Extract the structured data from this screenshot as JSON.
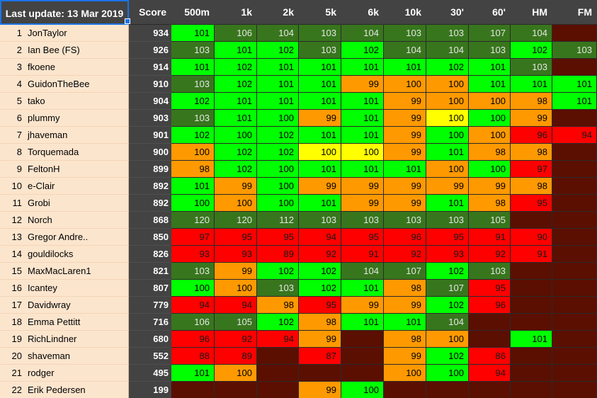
{
  "sheet": {
    "update_label": "Last update: 13 Mar 2019",
    "score_header": "Score",
    "columns": [
      "500m",
      "1k",
      "2k",
      "5k",
      "6k",
      "10k",
      "30'",
      "60'",
      "HM",
      "FM"
    ]
  },
  "colors": {
    "header_bg": "#434343",
    "name_bg": "#fce5cd",
    "dark_green": "#38761d",
    "green": "#00ff00",
    "orange": "#ff9900",
    "yellow": "#ffff00",
    "red": "#ff0000",
    "no_result": "#5b0f00",
    "selection": "#1a73e8"
  },
  "rows": [
    {
      "rank": "1",
      "name": "JonTaylor",
      "score": "934",
      "cells": [
        [
          "101",
          "g"
        ],
        [
          "106",
          "d"
        ],
        [
          "104",
          "d"
        ],
        [
          "103",
          "d"
        ],
        [
          "104",
          "d"
        ],
        [
          "103",
          "d"
        ],
        [
          "103",
          "d"
        ],
        [
          "107",
          "d"
        ],
        [
          "104",
          "d"
        ],
        [
          "",
          "x"
        ]
      ]
    },
    {
      "rank": "2",
      "name": "Ian Bee (FS)",
      "score": "926",
      "cells": [
        [
          "103",
          "d"
        ],
        [
          "101",
          "g"
        ],
        [
          "102",
          "g"
        ],
        [
          "103",
          "d"
        ],
        [
          "102",
          "g"
        ],
        [
          "104",
          "d"
        ],
        [
          "104",
          "d"
        ],
        [
          "103",
          "d"
        ],
        [
          "102",
          "g"
        ],
        [
          "103",
          "d"
        ]
      ]
    },
    {
      "rank": "3",
      "name": "fkoene",
      "score": "914",
      "cells": [
        [
          "101",
          "g"
        ],
        [
          "102",
          "g"
        ],
        [
          "101",
          "g"
        ],
        [
          "101",
          "g"
        ],
        [
          "101",
          "g"
        ],
        [
          "101",
          "g"
        ],
        [
          "102",
          "g"
        ],
        [
          "101",
          "g"
        ],
        [
          "103",
          "d"
        ],
        [
          "",
          "x"
        ]
      ]
    },
    {
      "rank": "4",
      "name": "GuidonTheBee",
      "score": "910",
      "cells": [
        [
          "103",
          "d"
        ],
        [
          "102",
          "g"
        ],
        [
          "101",
          "g"
        ],
        [
          "101",
          "g"
        ],
        [
          "99",
          "o"
        ],
        [
          "100",
          "o"
        ],
        [
          "100",
          "o"
        ],
        [
          "101",
          "g"
        ],
        [
          "101",
          "g"
        ],
        [
          "101",
          "g"
        ]
      ]
    },
    {
      "rank": "5",
      "name": "tako",
      "score": "904",
      "cells": [
        [
          "102",
          "g"
        ],
        [
          "101",
          "g"
        ],
        [
          "101",
          "g"
        ],
        [
          "101",
          "g"
        ],
        [
          "101",
          "g"
        ],
        [
          "99",
          "o"
        ],
        [
          "100",
          "o"
        ],
        [
          "100",
          "o"
        ],
        [
          "98",
          "o"
        ],
        [
          "101",
          "g"
        ]
      ]
    },
    {
      "rank": "6",
      "name": "plummy",
      "score": "903",
      "cells": [
        [
          "103",
          "d"
        ],
        [
          "101",
          "g"
        ],
        [
          "100",
          "g"
        ],
        [
          "99",
          "o"
        ],
        [
          "101",
          "g"
        ],
        [
          "99",
          "o"
        ],
        [
          "100",
          "y"
        ],
        [
          "100",
          "g"
        ],
        [
          "99",
          "o"
        ],
        [
          "",
          "x"
        ]
      ]
    },
    {
      "rank": "7",
      "name": "jhaveman",
      "score": "901",
      "cells": [
        [
          "102",
          "g"
        ],
        [
          "100",
          "g"
        ],
        [
          "102",
          "g"
        ],
        [
          "101",
          "g"
        ],
        [
          "101",
          "g"
        ],
        [
          "99",
          "o"
        ],
        [
          "100",
          "g"
        ],
        [
          "100",
          "o"
        ],
        [
          "96",
          "r"
        ],
        [
          "94",
          "r"
        ]
      ]
    },
    {
      "rank": "8",
      "name": "Torquemada",
      "score": "900",
      "cells": [
        [
          "100",
          "o"
        ],
        [
          "102",
          "g"
        ],
        [
          "102",
          "g"
        ],
        [
          "100",
          "y"
        ],
        [
          "100",
          "y"
        ],
        [
          "99",
          "o"
        ],
        [
          "101",
          "g"
        ],
        [
          "98",
          "o"
        ],
        [
          "98",
          "o"
        ],
        [
          "",
          "x"
        ]
      ]
    },
    {
      "rank": "9",
      "name": "FeltonH",
      "score": "899",
      "cells": [
        [
          "98",
          "o"
        ],
        [
          "102",
          "g"
        ],
        [
          "100",
          "g"
        ],
        [
          "101",
          "g"
        ],
        [
          "101",
          "g"
        ],
        [
          "101",
          "g"
        ],
        [
          "100",
          "o"
        ],
        [
          "100",
          "g"
        ],
        [
          "97",
          "r"
        ],
        [
          "",
          "x"
        ]
      ]
    },
    {
      "rank": "10",
      "name": "e-Clair",
      "score": "892",
      "cells": [
        [
          "101",
          "g"
        ],
        [
          "99",
          "o"
        ],
        [
          "100",
          "g"
        ],
        [
          "99",
          "o"
        ],
        [
          "99",
          "o"
        ],
        [
          "99",
          "o"
        ],
        [
          "99",
          "o"
        ],
        [
          "99",
          "o"
        ],
        [
          "98",
          "o"
        ],
        [
          "",
          "x"
        ]
      ]
    },
    {
      "rank": "11",
      "name": "Grobi",
      "score": "892",
      "cells": [
        [
          "100",
          "g"
        ],
        [
          "100",
          "o"
        ],
        [
          "100",
          "g"
        ],
        [
          "101",
          "g"
        ],
        [
          "99",
          "o"
        ],
        [
          "99",
          "o"
        ],
        [
          "101",
          "g"
        ],
        [
          "98",
          "o"
        ],
        [
          "95",
          "r"
        ],
        [
          "",
          "x"
        ]
      ]
    },
    {
      "rank": "12",
      "name": "Norch",
      "score": "868",
      "cells": [
        [
          "120",
          "d"
        ],
        [
          "120",
          "d"
        ],
        [
          "112",
          "d"
        ],
        [
          "103",
          "d"
        ],
        [
          "103",
          "d"
        ],
        [
          "103",
          "d"
        ],
        [
          "103",
          "d"
        ],
        [
          "105",
          "d"
        ],
        [
          "",
          "x"
        ],
        [
          "",
          "x"
        ]
      ]
    },
    {
      "rank": "13",
      "name": "Gregor Andre..",
      "score": "850",
      "cells": [
        [
          "97",
          "r"
        ],
        [
          "95",
          "r"
        ],
        [
          "95",
          "r"
        ],
        [
          "94",
          "r"
        ],
        [
          "95",
          "r"
        ],
        [
          "96",
          "r"
        ],
        [
          "95",
          "r"
        ],
        [
          "91",
          "r"
        ],
        [
          "90",
          "r"
        ],
        [
          "",
          "x"
        ]
      ]
    },
    {
      "rank": "14",
      "name": "gouldilocks",
      "score": "826",
      "cells": [
        [
          "93",
          "r"
        ],
        [
          "93",
          "r"
        ],
        [
          "89",
          "r"
        ],
        [
          "92",
          "r"
        ],
        [
          "91",
          "r"
        ],
        [
          "92",
          "r"
        ],
        [
          "93",
          "r"
        ],
        [
          "92",
          "r"
        ],
        [
          "91",
          "r"
        ],
        [
          "",
          "x"
        ]
      ]
    },
    {
      "rank": "15",
      "name": "MaxMacLaren1",
      "score": "821",
      "cells": [
        [
          "103",
          "d"
        ],
        [
          "99",
          "o"
        ],
        [
          "102",
          "g"
        ],
        [
          "102",
          "g"
        ],
        [
          "104",
          "d"
        ],
        [
          "107",
          "d"
        ],
        [
          "102",
          "g"
        ],
        [
          "103",
          "d"
        ],
        [
          "",
          "x"
        ],
        [
          "",
          "x"
        ]
      ]
    },
    {
      "rank": "16",
      "name": "Icantey",
      "score": "807",
      "cells": [
        [
          "100",
          "g"
        ],
        [
          "100",
          "o"
        ],
        [
          "103",
          "d"
        ],
        [
          "102",
          "g"
        ],
        [
          "101",
          "g"
        ],
        [
          "98",
          "o"
        ],
        [
          "107",
          "d"
        ],
        [
          "95",
          "r"
        ],
        [
          "",
          "x"
        ],
        [
          "",
          "x"
        ]
      ]
    },
    {
      "rank": "17",
      "name": "Davidwray",
      "score": "779",
      "cells": [
        [
          "94",
          "r"
        ],
        [
          "94",
          "r"
        ],
        [
          "98",
          "o"
        ],
        [
          "95",
          "r"
        ],
        [
          "99",
          "o"
        ],
        [
          "99",
          "o"
        ],
        [
          "102",
          "g"
        ],
        [
          "96",
          "r"
        ],
        [
          "",
          "x"
        ],
        [
          "",
          "x"
        ]
      ]
    },
    {
      "rank": "18",
      "name": "Emma Pettitt",
      "score": "716",
      "cells": [
        [
          "106",
          "d"
        ],
        [
          "105",
          "d"
        ],
        [
          "102",
          "g"
        ],
        [
          "98",
          "o"
        ],
        [
          "101",
          "g"
        ],
        [
          "101",
          "g"
        ],
        [
          "104",
          "d"
        ],
        [
          "",
          "x"
        ],
        [
          "",
          "x"
        ],
        [
          "",
          "x"
        ]
      ]
    },
    {
      "rank": "19",
      "name": "RichLindner",
      "score": "680",
      "cells": [
        [
          "96",
          "r"
        ],
        [
          "92",
          "r"
        ],
        [
          "94",
          "r"
        ],
        [
          "99",
          "o"
        ],
        [
          "",
          "x"
        ],
        [
          "98",
          "o"
        ],
        [
          "100",
          "o"
        ],
        [
          "",
          "x"
        ],
        [
          "101",
          "g"
        ],
        [
          "",
          "x"
        ]
      ]
    },
    {
      "rank": "20",
      "name": "shaveman",
      "score": "552",
      "cells": [
        [
          "88",
          "r"
        ],
        [
          "89",
          "r"
        ],
        [
          "",
          "x"
        ],
        [
          "87",
          "r"
        ],
        [
          "",
          "x"
        ],
        [
          "99",
          "o"
        ],
        [
          "102",
          "g"
        ],
        [
          "86",
          "r"
        ],
        [
          "",
          "x"
        ],
        [
          "",
          "x"
        ]
      ]
    },
    {
      "rank": "21",
      "name": "rodger",
      "score": "495",
      "cells": [
        [
          "101",
          "g"
        ],
        [
          "100",
          "o"
        ],
        [
          "",
          "x"
        ],
        [
          "",
          "x"
        ],
        [
          "",
          "x"
        ],
        [
          "100",
          "o"
        ],
        [
          "100",
          "g"
        ],
        [
          "94",
          "r"
        ],
        [
          "",
          "x"
        ],
        [
          "",
          "x"
        ]
      ]
    },
    {
      "rank": "22",
      "name": "Erik Pedersen",
      "score": "199",
      "cells": [
        [
          "",
          "x"
        ],
        [
          "",
          "x"
        ],
        [
          "",
          "x"
        ],
        [
          "99",
          "o"
        ],
        [
          "100",
          "g"
        ],
        [
          "",
          "x"
        ],
        [
          "",
          "x"
        ],
        [
          "",
          "x"
        ],
        [
          "",
          "x"
        ],
        [
          "",
          "x"
        ]
      ]
    }
  ]
}
